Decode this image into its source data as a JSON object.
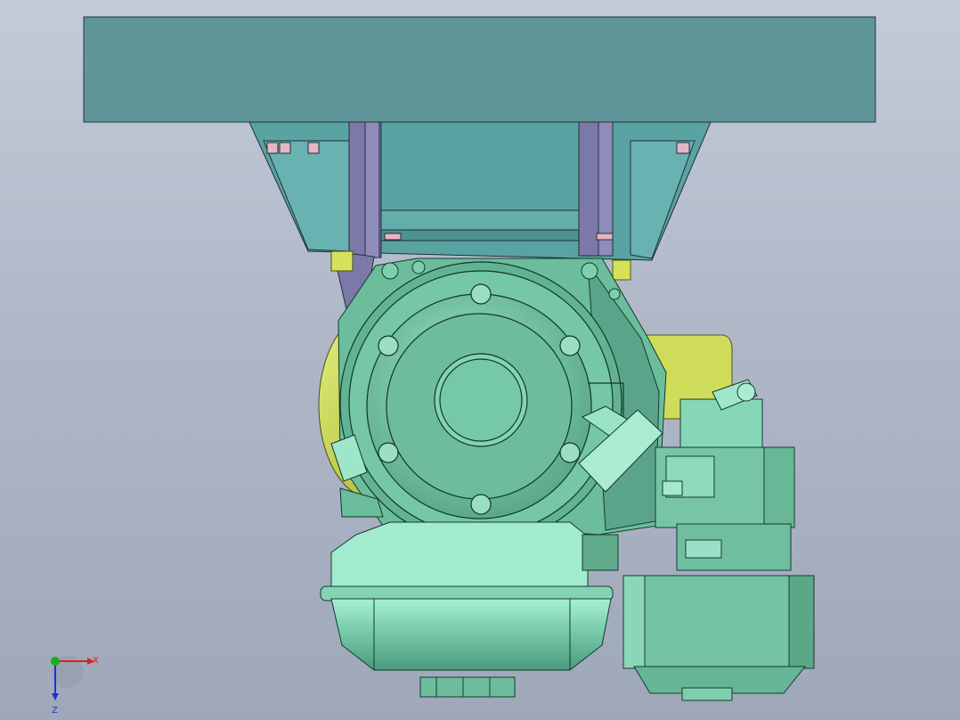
{
  "triad": {
    "x_label": "X",
    "z_label": "Z",
    "x_color": "#e02020",
    "y_color": "#18b018",
    "z_color": "#2030d0"
  },
  "colors": {
    "background_top": "#c4cbd8",
    "background_bottom": "#9ea8b9",
    "mount_plate": "#5f9598",
    "bracket_teal": "#5c9fa0",
    "bracket_purple": "#7a78a6",
    "engine_green": "#6fbf9e",
    "engine_light": "#8fdcc0",
    "yellow_part": "#c9d84a",
    "bolt_pink": "#e3b8c4"
  },
  "parts": [
    "mount-plate",
    "support-bracket",
    "engine-crankcase",
    "starter-cover",
    "fuel-tank",
    "carburetor",
    "air-filter",
    "yellow-flywheel-housing",
    "yellow-tank"
  ]
}
